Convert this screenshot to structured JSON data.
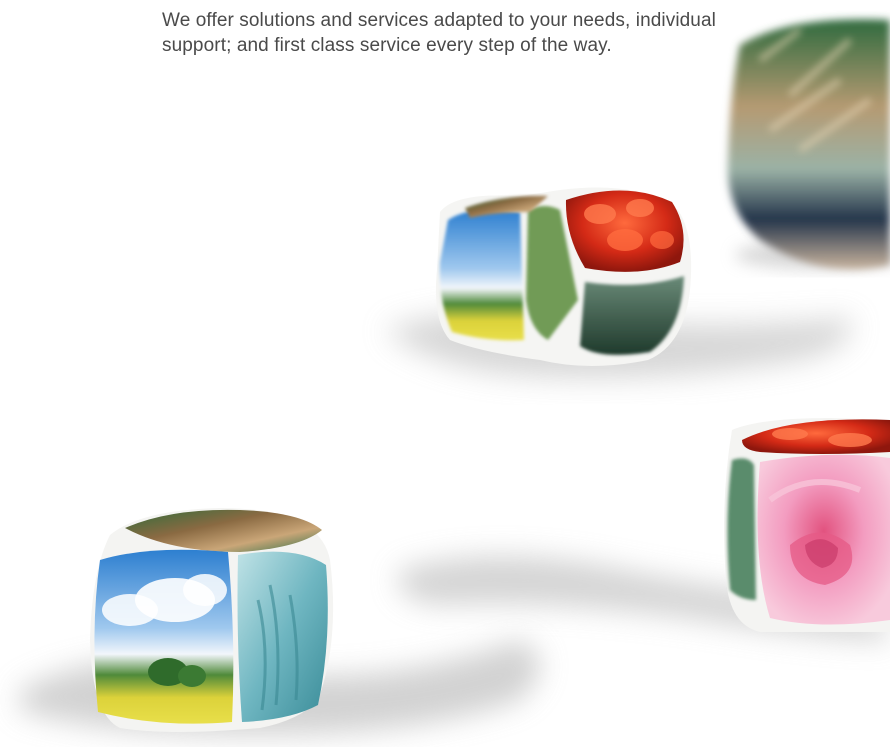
{
  "intro": {
    "text": "We offer solutions and services adapted to your needs, individual support; and first class service every step of the way."
  },
  "illustration": {
    "subject": "photo-dice",
    "colors": {
      "background": "#ffffff",
      "text": "#4a4a4a",
      "sky": "#3f8fd6",
      "field": "#d8d43a",
      "tomato": "#d9321b",
      "rose": "#ef8bb3",
      "leaf": "#2f7a4a",
      "shadow": "#c8c8c8"
    }
  }
}
